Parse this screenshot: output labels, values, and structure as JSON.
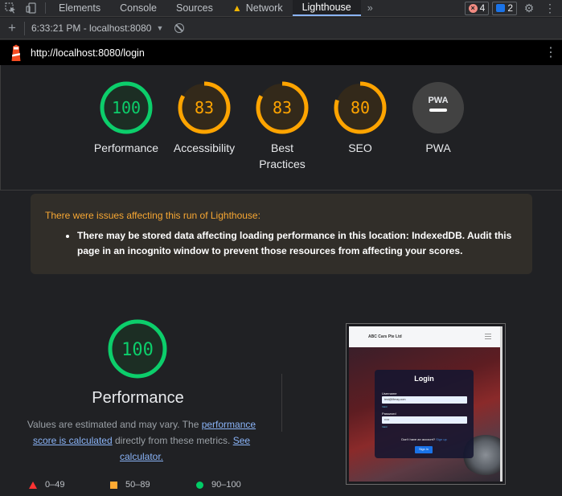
{
  "devtools": {
    "tabs": [
      "Elements",
      "Console",
      "Sources",
      "Network",
      "Lighthouse"
    ],
    "active_tab": "Lighthouse",
    "network_warning_icon": "warning-triangle-icon",
    "error_count": "4",
    "message_count": "2"
  },
  "toolbar": {
    "report_selector": "6:33:21 PM - localhost:8080"
  },
  "urlbar": {
    "url": "http://localhost:8080/login"
  },
  "scores": [
    {
      "label": "Performance",
      "score": 100,
      "color": "#0cce6b"
    },
    {
      "label": "Accessibility",
      "score": 83,
      "color": "#ffa400"
    },
    {
      "label": "Best\nPractices",
      "score": 83,
      "color": "#ffa400"
    },
    {
      "label": "SEO",
      "score": 80,
      "color": "#ffa400"
    },
    {
      "label": "PWA",
      "score": null,
      "color": "#9aa0a6"
    }
  ],
  "pwa_badge_text": "PWA",
  "warning": {
    "title": "There were issues affecting this run of Lighthouse:",
    "item": "There may be stored data affecting loading performance in this location: IndexedDB. Audit this page in an incognito window to prevent those resources from affecting your scores."
  },
  "performance": {
    "score": 100,
    "title": "Performance",
    "desc_prefix": "Values are estimated and may vary. The ",
    "desc_link1": "performance score is calculated",
    "desc_middle": " directly from these metrics. ",
    "desc_link2": "See calculator."
  },
  "legend": [
    {
      "shape": "triangle",
      "range": "0–49",
      "color": "#ff3333"
    },
    {
      "shape": "square",
      "range": "50–89",
      "color": "#ffaa33"
    },
    {
      "shape": "circle",
      "range": "90–100",
      "color": "#00cc66"
    }
  ],
  "thumbnail": {
    "brand": "ABC Cars Pte Ltd",
    "login_title": "Login",
    "username_label": "Username",
    "username_value": "test@liferay.com",
    "username_help": "Valid",
    "password_label": "Password",
    "password_value": "•••••",
    "password_help": "Valid",
    "no_account": "Don't have an account?",
    "sign_up": "Sign up",
    "sign_in": "Sign In"
  }
}
